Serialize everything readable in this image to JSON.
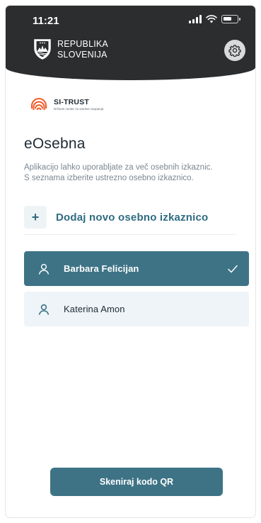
{
  "status_bar": {
    "time": "11:21"
  },
  "header": {
    "brand_line1": "REPUBLIKA",
    "brand_line2": "SLOVENIJA",
    "settings_icon": "gear-icon"
  },
  "issuer": {
    "name": "SI-TRUST",
    "subtitle": "Državni center za storitve zaupanja"
  },
  "main": {
    "title": "eOsebna",
    "description_line1": "Aplikacijo lahko uporabljate za več osebnih izkaznic.",
    "description_line2": "S seznama izberite ustrezno osebno izkaznico.",
    "add_label": "Dodaj novo osebno izkaznico",
    "add_icon": "plus-icon"
  },
  "cards": [
    {
      "name": "Barbara Felicijan",
      "selected": true
    },
    {
      "name": "Katerina Amon",
      "selected": false
    }
  ],
  "footer": {
    "scan_label": "Skeniraj kodo QR"
  },
  "colors": {
    "header_bg": "#2b2d2f",
    "accent": "#3e7386",
    "accent_text": "#2f6c82",
    "card_bg": "#eef4f7",
    "brand_orange": "#f05a28"
  }
}
